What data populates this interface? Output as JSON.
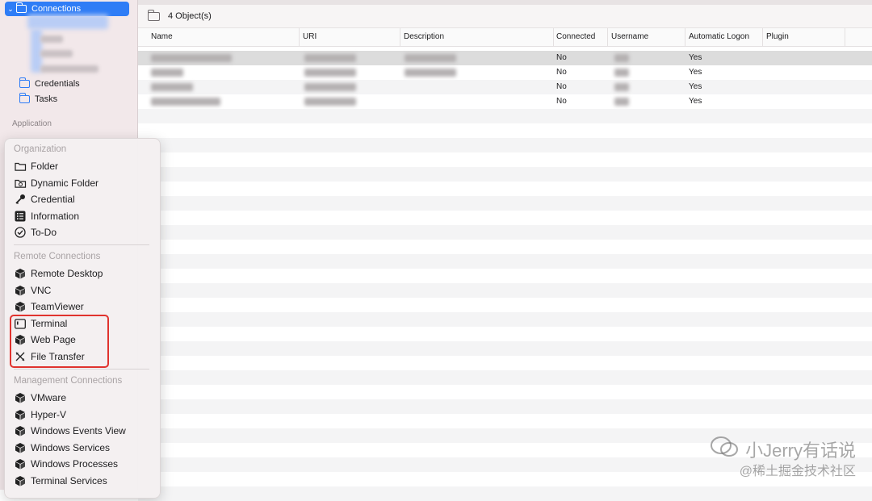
{
  "sidebar": {
    "selected_label": "Connections",
    "credentials_label": "Credentials",
    "tasks_label": "Tasks",
    "application_header": "Application"
  },
  "main": {
    "object_count": "4 Object(s)",
    "columns": [
      "Name",
      "URI",
      "Description",
      "Connected",
      "Username",
      "Automatic Logon",
      "Plugin"
    ],
    "rows": [
      {
        "connected": "No",
        "automatic_logon": "Yes"
      },
      {
        "connected": "No",
        "automatic_logon": "Yes"
      },
      {
        "connected": "No",
        "automatic_logon": "Yes"
      },
      {
        "connected": "No",
        "automatic_logon": "Yes"
      }
    ]
  },
  "menu": {
    "organization_header": "Organization",
    "organization_items": [
      {
        "label": "Folder",
        "icon": "folder-icon"
      },
      {
        "label": "Dynamic Folder",
        "icon": "dynamic-folder-icon"
      },
      {
        "label": "Credential",
        "icon": "key-icon"
      },
      {
        "label": "Information",
        "icon": "list-icon"
      },
      {
        "label": "To-Do",
        "icon": "checkmark-circle-icon"
      }
    ],
    "remote_header": "Remote Connections",
    "remote_items": [
      {
        "label": "Remote Desktop",
        "icon": "cube-icon"
      },
      {
        "label": "VNC",
        "icon": "cube-icon"
      },
      {
        "label": "TeamViewer",
        "icon": "cube-icon"
      },
      {
        "label": "Terminal",
        "icon": "terminal-icon"
      },
      {
        "label": "Web Page",
        "icon": "cube-icon"
      },
      {
        "label": "File Transfer",
        "icon": "file-transfer-icon"
      }
    ],
    "management_header": "Management Connections",
    "management_items": [
      {
        "label": "VMware",
        "icon": "cube-icon"
      },
      {
        "label": "Hyper-V",
        "icon": "cube-icon"
      },
      {
        "label": "Windows Events View",
        "icon": "cube-icon"
      },
      {
        "label": "Windows Services",
        "icon": "cube-icon"
      },
      {
        "label": "Windows Processes",
        "icon": "cube-icon"
      },
      {
        "label": "Terminal Services",
        "icon": "cube-icon"
      }
    ]
  },
  "watermark": {
    "line1": "小Jerry有话说",
    "line2": "@稀土掘金技术社区"
  },
  "colors": {
    "selection": "#2f7df6",
    "highlight_box": "#e0332e",
    "sidebar_bg": "#f2e8ea"
  }
}
